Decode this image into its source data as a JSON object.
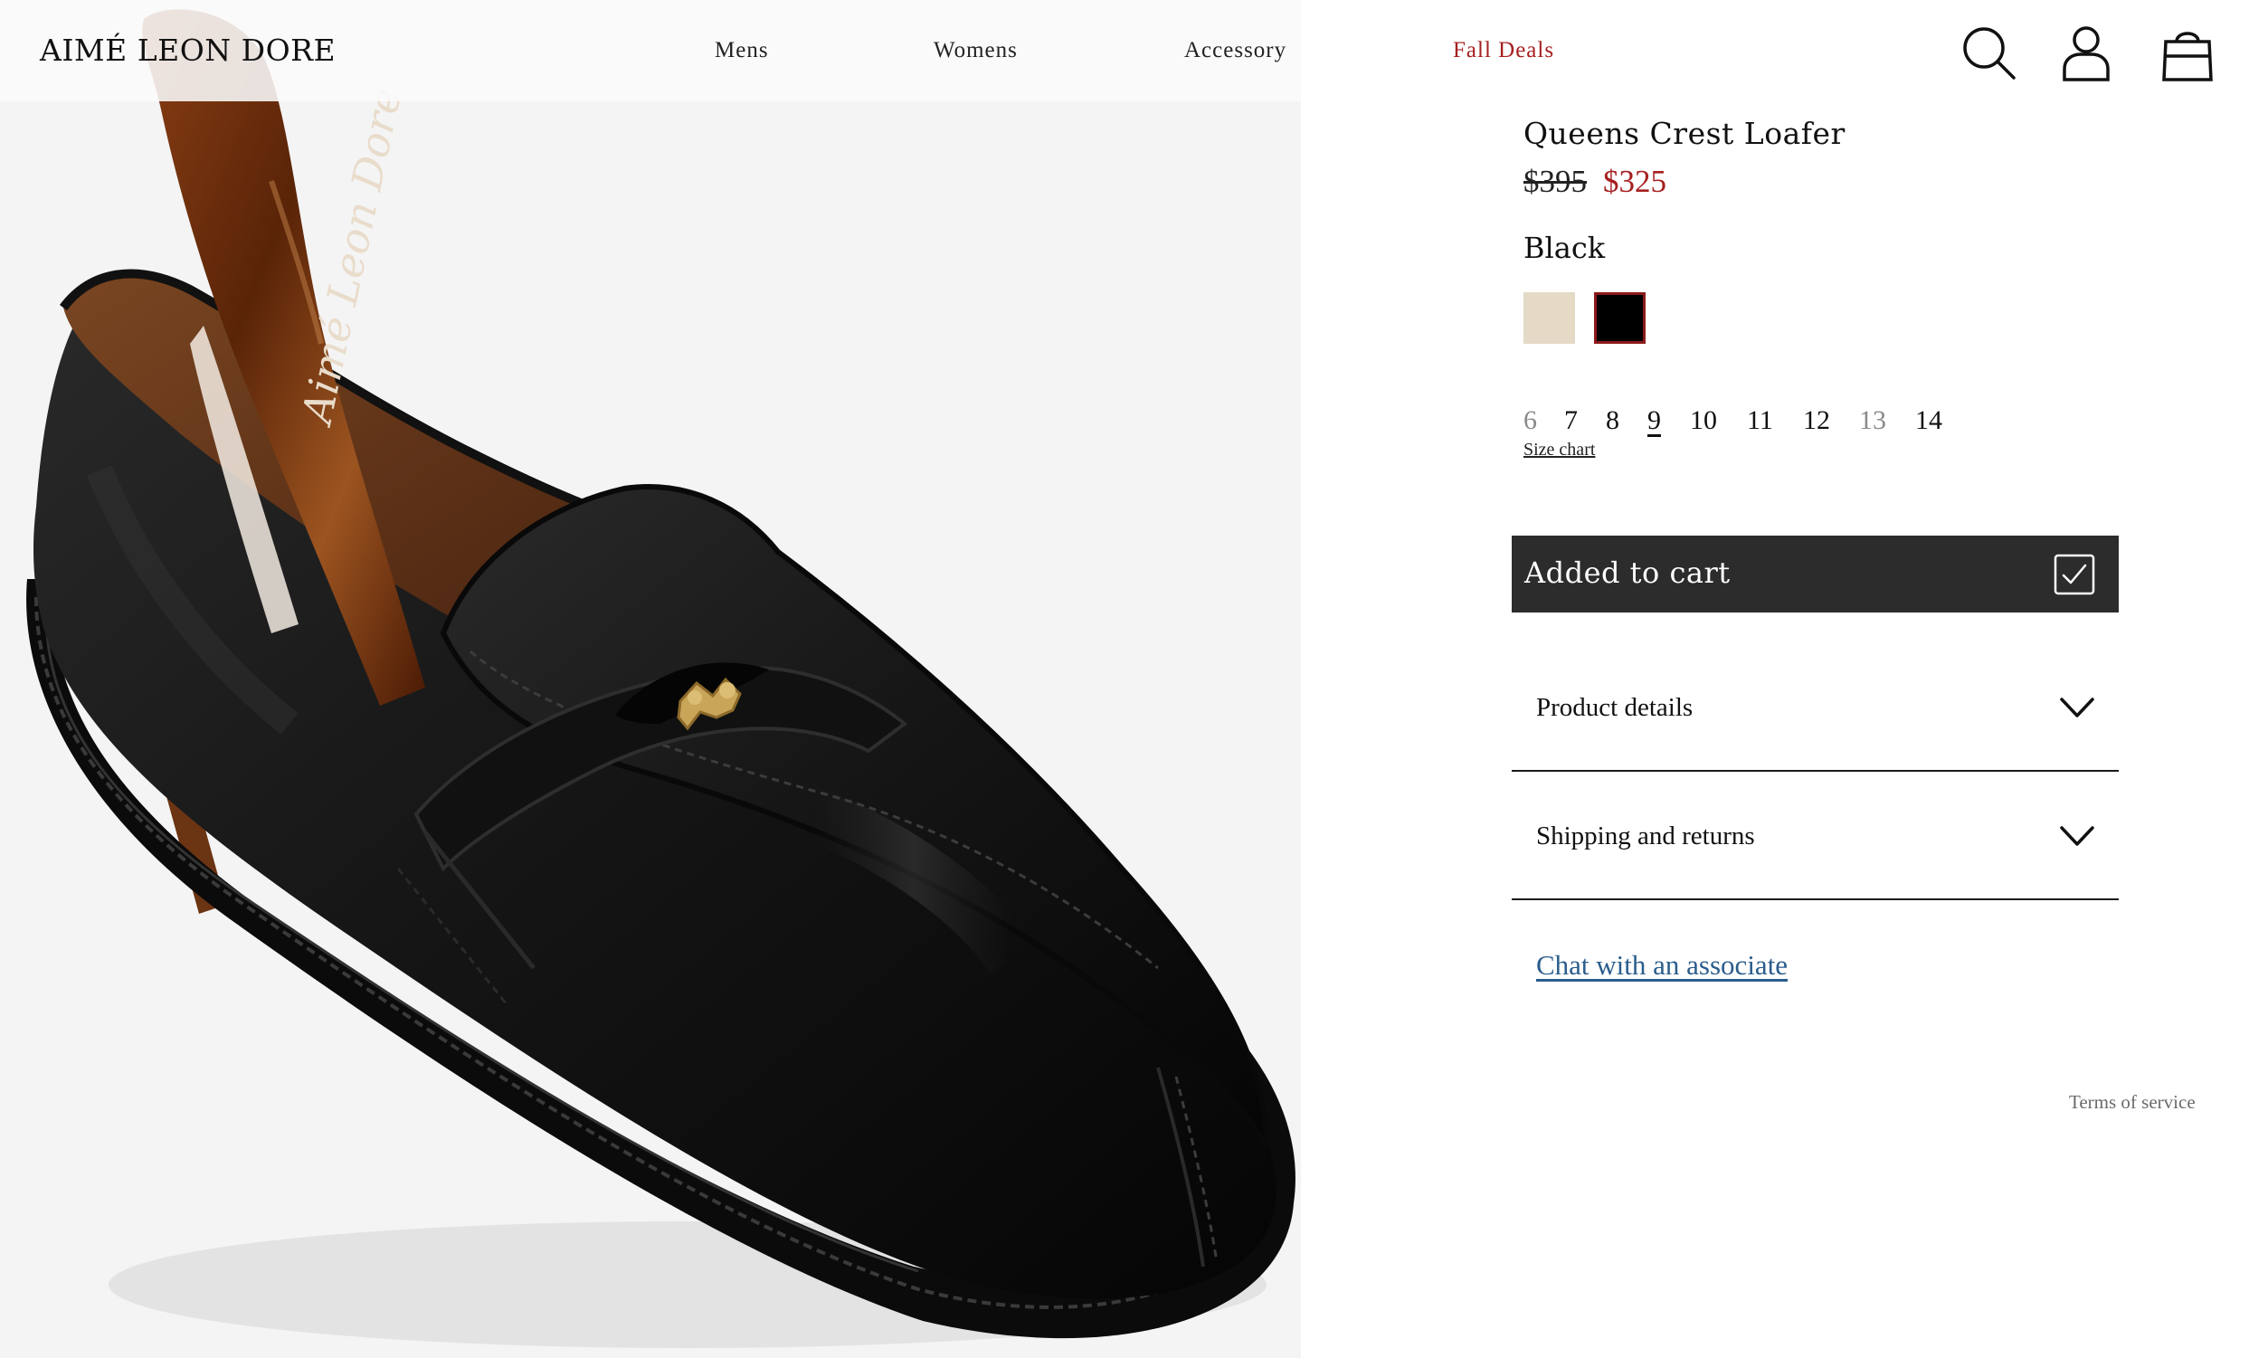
{
  "header": {
    "brand": "AIMÉ LEON DORE",
    "nav": [
      {
        "label": "Mens"
      },
      {
        "label": "Womens"
      },
      {
        "label": "Accessory"
      },
      {
        "label": "Fall Deals",
        "color": "#a61f1f"
      }
    ],
    "icons": [
      "search-icon",
      "account-icon",
      "shopping-bag-icon"
    ]
  },
  "product_image": {
    "engraving": "Aimé Leon Dore"
  },
  "product": {
    "title": "Queens Crest Loafer",
    "price_original": "$395",
    "price_sale": "$325",
    "sale_color": "#a61f1f",
    "color_name": "Black",
    "swatches": [
      {
        "name": "cream",
        "hex": "#e4dac6",
        "selected": false
      },
      {
        "name": "black",
        "hex": "#000000",
        "selected": true
      }
    ],
    "sizes": [
      {
        "label": "6",
        "available": false
      },
      {
        "label": "7",
        "available": true
      },
      {
        "label": "8",
        "available": true
      },
      {
        "label": "9",
        "available": true,
        "selected": true
      },
      {
        "label": "10",
        "available": true
      },
      {
        "label": "11",
        "available": true
      },
      {
        "label": "12",
        "available": true
      },
      {
        "label": "13",
        "available": false
      },
      {
        "label": "14",
        "available": true
      }
    ],
    "size_chart_label": "Size chart",
    "cart_button_label": "Added to cart",
    "accordions": [
      {
        "label": "Product details"
      },
      {
        "label": "Shipping and returns"
      }
    ],
    "chat_link": "Chat with an associate",
    "link_color": "#2a5d8c"
  },
  "footer": {
    "terms": "Terms of service"
  }
}
